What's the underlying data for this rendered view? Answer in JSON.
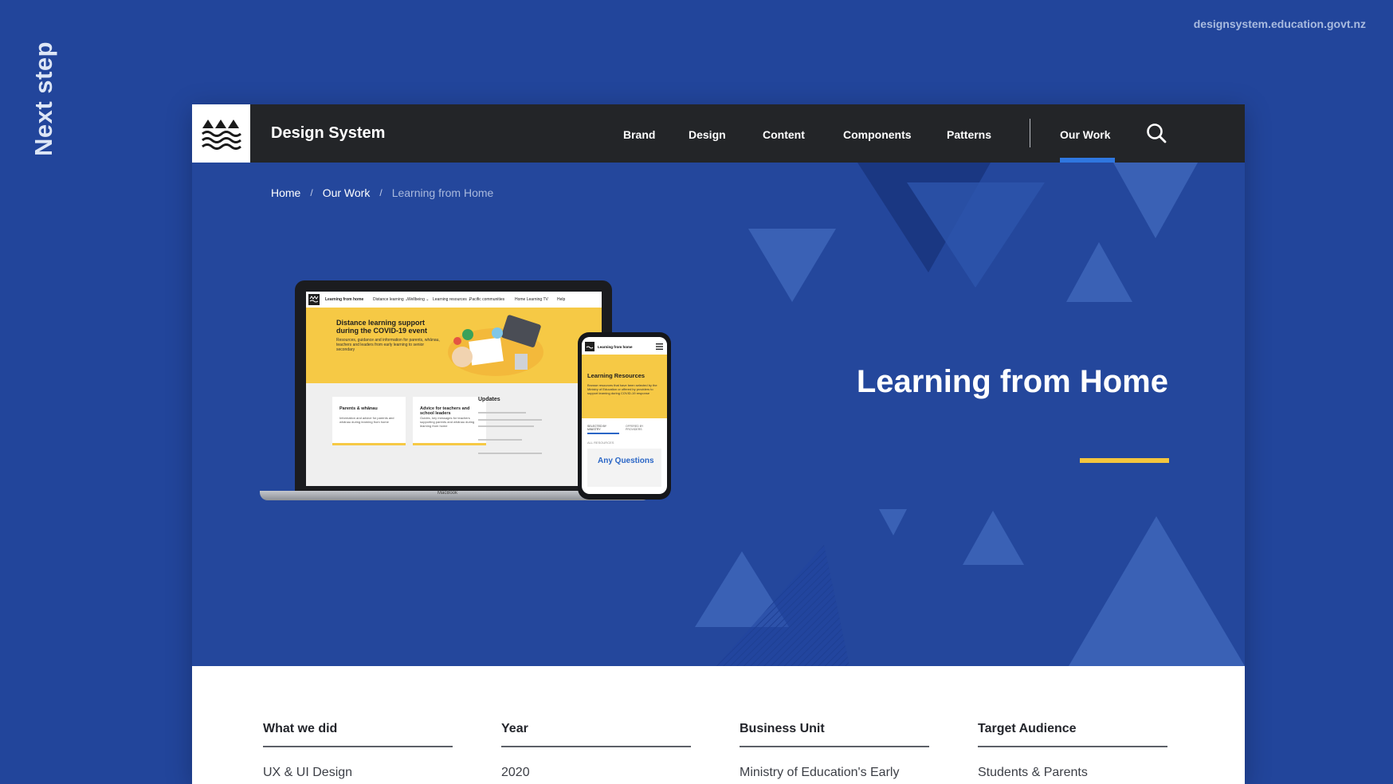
{
  "slide": {
    "side_label": "Next step",
    "url": "designsystem.education.govt.nz"
  },
  "site": {
    "brand_title": "Design System",
    "nav": [
      {
        "label": "Brand"
      },
      {
        "label": "Design"
      },
      {
        "label": "Content"
      },
      {
        "label": "Components"
      },
      {
        "label": "Patterns"
      },
      {
        "label": "Our Work",
        "active": true
      }
    ],
    "search_icon": "search-icon",
    "logo_icon": "mountains-waves-icon"
  },
  "breadcrumb": {
    "items": [
      "Home",
      "Our Work",
      "Learning from Home"
    ],
    "separator": "/"
  },
  "hero": {
    "title": "Learning from Home",
    "accent_color": "#f4c63d",
    "background_color": "#24479c"
  },
  "mockup": {
    "laptop": {
      "nav_title": "Learning from home",
      "nav_links": [
        "Distance learning ⌄",
        "Wellbeing ⌄",
        "Learning resources ⌄",
        "Pacific communities",
        "Home Learning TV",
        "Help"
      ],
      "headline": "Distance learning support during the COVID-19 event",
      "subtext": "Resources, guidance and information for parents, whānau, teachers and leaders from early learning to senior secondary",
      "cards": [
        {
          "title": "Parents & whānau",
          "desc": "Information and advice for parents and whānau during learning from home"
        },
        {
          "title": "Advice for teachers and school leaders",
          "desc": "Guides, key messages for teachers supporting parents and whānau during learning from home"
        }
      ],
      "updates_title": "Updates",
      "base_label": "MacBook"
    },
    "phone": {
      "nav_title": "Learning from home",
      "headline": "Learning Resources",
      "subtext": "Browse resources that have been selected by the Ministry of Education or offered by providers to support learning during COVID-19 response",
      "tabs": [
        "SELECTED BY MINISTRY",
        "OFFERED BY PROVIDERS"
      ],
      "filter": "ALL RESOURCES",
      "promo": "Any Questions"
    }
  },
  "details": {
    "columns": [
      {
        "heading": "What we did",
        "value": "UX & UI Design"
      },
      {
        "heading": "Year",
        "value": "2020"
      },
      {
        "heading": "Business Unit",
        "value": "Ministry of Education's Early"
      },
      {
        "heading": "Target Audience",
        "value": "Students & Parents"
      }
    ]
  }
}
